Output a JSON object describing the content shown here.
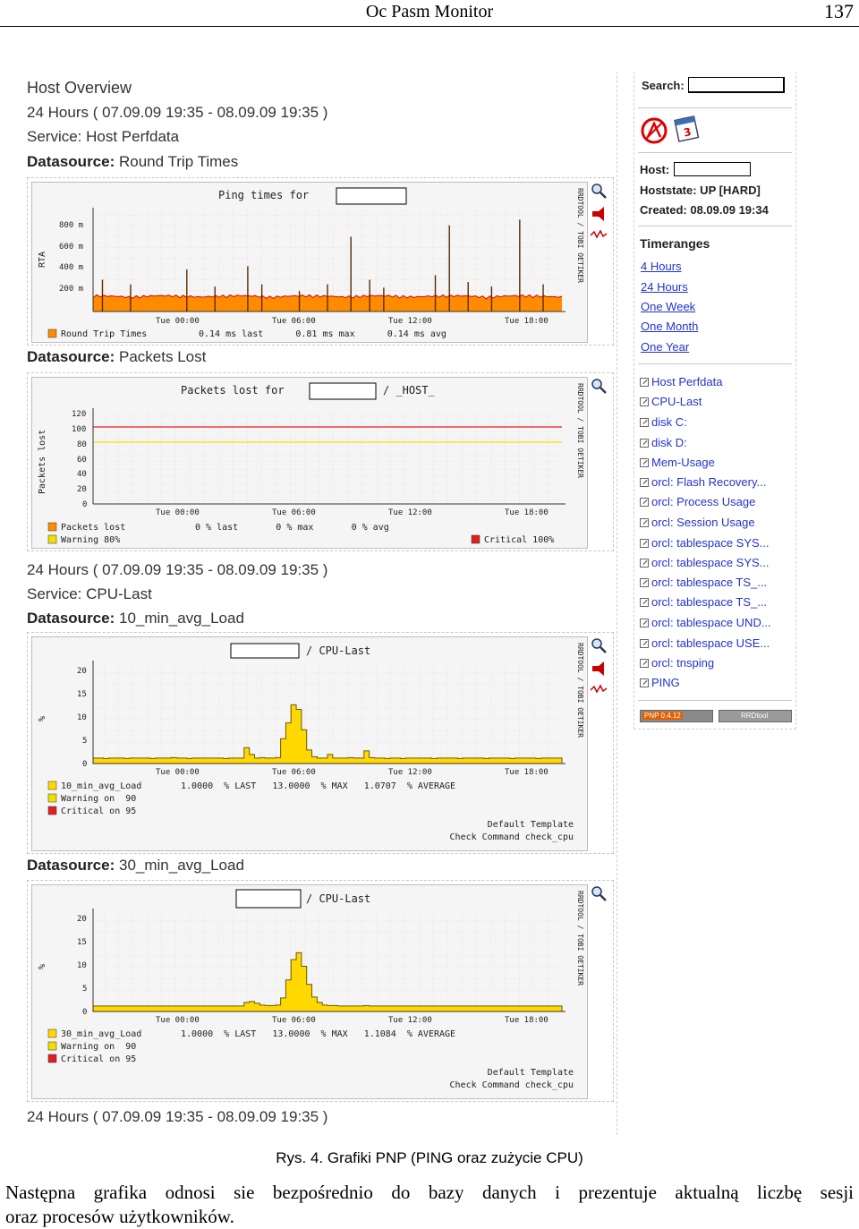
{
  "header": {
    "title": "Oc Pasm Monitor",
    "page_number": "137"
  },
  "main": {
    "host_overview": "Host Overview",
    "timerange_top": "24 Hours ( 07.09.09 19:35 - 08.09.09 19:35 )",
    "service_perf": "Service: Host Perfdata",
    "ds_rtt_label": "Datasource:",
    "ds_rtt_value": "Round Trip Times",
    "ds_pl_label": "Datasource:",
    "ds_pl_value": "Packets Lost",
    "timerange_mid": "24 Hours ( 07.09.09 19:35 - 08.09.09 19:35 )",
    "service_cpu": "Service: CPU-Last",
    "ds_10_label": "Datasource:",
    "ds_10_value": "10_min_avg_Load",
    "ds_30_label": "Datasource:",
    "ds_30_value": "30_min_avg_Load",
    "timerange_bottom": "24 Hours ( 07.09.09 19:35 - 08.09.09 19:35 )"
  },
  "graph_common": {
    "x_ticks": [
      "Tue 00:00",
      "Tue 06:00",
      "Tue 12:00",
      "Tue 18:00"
    ],
    "side_vertical": "RRDTOOL / TOBI OETIKER"
  },
  "graph_ping": {
    "title": "Ping times for",
    "ylabel": "RTA",
    "y_ticks": [
      "800 m",
      "600 m",
      "400 m",
      "200 m"
    ],
    "legend_name": "Round Trip Times",
    "legend_stats": "0.14 ms last      0.81 ms max      0.14 ms avg"
  },
  "graph_packets": {
    "title": "Packets lost for",
    "title_suffix": "/ _HOST_",
    "ylabel": "Packets lost",
    "y_ticks": [
      "120",
      "100",
      "80",
      "60",
      "40",
      "20",
      "0"
    ],
    "legend_lost": "Packets lost",
    "legend_lost_stats": "0 % last       0 % max       0 % avg",
    "legend_warning": "Warning 80%",
    "legend_critical": "Critical 100%"
  },
  "graph_cpu10": {
    "title_suffix": "/ CPU-Last",
    "ylabel": "%",
    "y_ticks": [
      "20",
      "15",
      "10",
      "5",
      "0"
    ],
    "legend_name": "10_min_avg_Load",
    "legend_stats": "1.0000  % LAST   13.0000  % MAX   1.0707  % AVERAGE",
    "legend_warning": "Warning on  90",
    "legend_critical": "Critical on 95",
    "template": "Default Template",
    "command": "Check Command check_cpu"
  },
  "graph_cpu30": {
    "title_suffix": "/ CPU-Last",
    "ylabel": "%",
    "y_ticks": [
      "20",
      "15",
      "10",
      "5",
      "0"
    ],
    "legend_name": "30_min_avg_Load",
    "legend_stats": "1.0000  % LAST   13.0000  % MAX   1.1084  % AVERAGE",
    "legend_warning": "Warning on  90",
    "legend_critical": "Critical on 95",
    "template": "Default Template",
    "command": "Check Command check_cpu"
  },
  "sidebar": {
    "search_label": "Search:",
    "host_label": "Host:",
    "hoststate": "Hoststate: UP [HARD]",
    "created": "Created: 08.09.09 19:34",
    "timeranges_title": "Timeranges",
    "timeranges": [
      "4 Hours",
      "24 Hours",
      "One Week",
      "One Month",
      "One Year"
    ],
    "services": [
      "Host Perfdata",
      "CPU-Last",
      "disk C:",
      "disk D:",
      "Mem-Usage",
      "orcl: Flash Recovery...",
      "orcl: Process Usage",
      "orcl: Session Usage",
      "orcl: tablespace SYS...",
      "orcl: tablespace SYS...",
      "orcl: tablespace TS_...",
      "orcl: tablespace TS_...",
      "orcl: tablespace UND...",
      "orcl: tablespace USE...",
      "orcl: tnsping",
      "PING"
    ],
    "badge_pnp": "PNP 0.4.12",
    "badge_rrd": "RRDtool"
  },
  "caption": "Rys. 4. Grafiki PNP (PING oraz zużycie CPU)",
  "paragraph_line1": "Następna grafika odnosi sie bezpośrednio do bazy danych i prezentuje aktualną liczbę sesji",
  "paragraph_line2": "oraz procesów użytkowników.",
  "chart_data": [
    {
      "type": "area",
      "title": "Ping times for",
      "ylabel": "RTA",
      "x_ticks": [
        "Tue 00:00",
        "Tue 06:00",
        "Tue 12:00",
        "Tue 18:00"
      ],
      "y_ticks": [
        "200 m",
        "400 m",
        "600 m",
        "800 m"
      ],
      "ylim": [
        0,
        0.9
      ],
      "series": [
        {
          "name": "Round Trip Times",
          "last": 0.14,
          "max": 0.81,
          "avg": 0.14,
          "unit": "ms"
        }
      ],
      "spikes": [
        [
          0.02,
          0.28
        ],
        [
          0.08,
          0.24
        ],
        [
          0.2,
          0.37
        ],
        [
          0.26,
          0.22
        ],
        [
          0.33,
          0.4
        ],
        [
          0.36,
          0.24
        ],
        [
          0.44,
          0.18
        ],
        [
          0.5,
          0.24
        ],
        [
          0.55,
          0.66
        ],
        [
          0.59,
          0.28
        ],
        [
          0.62,
          0.21
        ],
        [
          0.73,
          0.32
        ],
        [
          0.76,
          0.76
        ],
        [
          0.8,
          0.26
        ],
        [
          0.85,
          0.22
        ],
        [
          0.91,
          0.81
        ],
        [
          0.96,
          0.24
        ]
      ],
      "colors": {
        "area": "#ff8c00",
        "top": "#d60000"
      }
    },
    {
      "type": "line",
      "title": "Packets lost for",
      "ylabel": "Packets lost",
      "x_ticks": [
        "Tue 00:00",
        "Tue 06:00",
        "Tue 12:00",
        "Tue 18:00"
      ],
      "y_ticks": [
        0,
        20,
        40,
        60,
        80,
        100,
        120
      ],
      "ylim": [
        0,
        120
      ],
      "series": [
        {
          "name": "Packets lost",
          "last": 0,
          "max": 0,
          "avg": 0,
          "unit": "%"
        },
        {
          "name": "Warning 80%",
          "value": 80,
          "color": "#f0e000"
        },
        {
          "name": "Critical 100%",
          "value": 100,
          "color": "#e02020"
        }
      ]
    },
    {
      "type": "area",
      "title": "/ CPU-Last",
      "ylabel": "%",
      "x_ticks": [
        "Tue 00:00",
        "Tue 06:00",
        "Tue 12:00",
        "Tue 18:00"
      ],
      "y_ticks": [
        0,
        5,
        10,
        15,
        20
      ],
      "ylim": [
        0,
        22
      ],
      "series": [
        {
          "name": "10_min_avg_Load",
          "last": 1.0,
          "max": 13.0,
          "avg": 1.0707,
          "unit": "%"
        }
      ],
      "values": [
        1.2,
        1.2,
        1.1,
        1.2,
        1.2,
        1.2,
        1.1,
        1.2,
        1.2,
        1.2,
        1.2,
        1.1,
        1.2,
        1.2,
        1.2,
        1.3,
        1.2,
        1.2,
        1.1,
        1.2,
        1.2,
        1.2,
        1.2,
        1.2,
        1.2,
        1.1,
        1.2,
        1.2,
        1.2,
        3.5,
        2.0,
        1.2,
        1.3,
        1.2,
        1.2,
        1.3,
        5.5,
        9.0,
        13.0,
        12.0,
        7.5,
        3.0,
        1.5,
        1.2,
        1.2,
        2.0,
        1.2,
        1.2,
        1.2,
        1.3,
        1.2,
        1.2,
        2.8,
        1.3,
        1.2,
        1.2,
        1.1,
        1.2,
        1.2,
        1.1,
        1.2,
        1.2,
        1.2,
        1.2,
        1.2,
        1.1,
        1.2,
        1.2,
        1.2,
        1.2,
        1.1,
        1.2,
        1.2,
        1.2,
        1.2,
        1.1,
        1.2,
        1.2,
        1.2,
        1.2,
        1.1,
        1.2,
        1.2,
        1.2,
        1.2,
        1.1,
        1.2,
        1.2,
        1.2,
        1.2
      ],
      "colors": {
        "area": "#ffd800",
        "outline": "#6a5a00"
      }
    },
    {
      "type": "area",
      "title": "/ CPU-Last",
      "ylabel": "%",
      "x_ticks": [
        "Tue 00:00",
        "Tue 06:00",
        "Tue 12:00",
        "Tue 18:00"
      ],
      "y_ticks": [
        0,
        5,
        10,
        15,
        20
      ],
      "ylim": [
        0,
        22
      ],
      "series": [
        {
          "name": "30_min_avg_Load",
          "last": 1.0,
          "max": 13.0,
          "avg": 1.1084,
          "unit": "%"
        }
      ],
      "values": [
        1.2,
        1.2,
        1.2,
        1.2,
        1.2,
        1.2,
        1.2,
        1.2,
        1.2,
        1.2,
        1.2,
        1.2,
        1.2,
        1.2,
        1.2,
        1.2,
        1.2,
        1.2,
        1.2,
        1.2,
        1.2,
        1.2,
        1.2,
        1.2,
        1.2,
        1.2,
        1.2,
        1.2,
        1.2,
        2.0,
        2.2,
        1.8,
        1.4,
        1.3,
        1.3,
        1.4,
        3.0,
        7.0,
        11.5,
        13.0,
        10.0,
        6.0,
        3.2,
        2.0,
        1.4,
        1.3,
        1.3,
        1.2,
        1.2,
        1.2,
        1.2,
        1.2,
        1.3,
        1.2,
        1.2,
        1.2,
        1.2,
        1.2,
        1.2,
        1.2,
        1.2,
        1.2,
        1.2,
        1.2,
        1.2,
        1.2,
        1.2,
        1.2,
        1.2,
        1.2,
        1.2,
        1.2,
        1.2,
        1.2,
        1.2,
        1.2,
        1.2,
        1.2,
        1.2,
        1.2,
        1.2,
        1.2,
        1.2,
        1.2,
        1.2,
        1.2,
        1.2,
        1.2,
        1.2,
        1.2
      ],
      "colors": {
        "area": "#ffd800",
        "outline": "#6a5a00"
      }
    }
  ]
}
